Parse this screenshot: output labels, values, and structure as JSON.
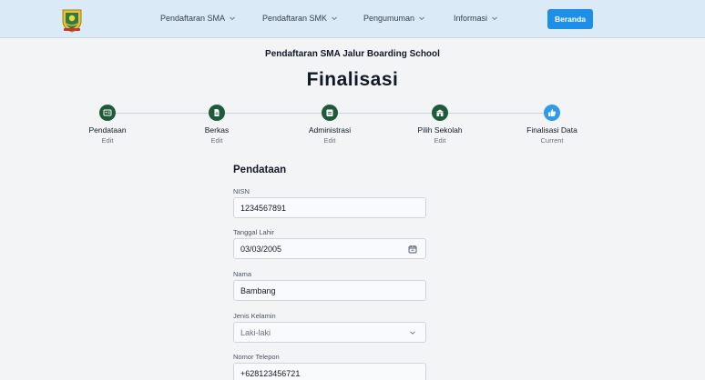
{
  "nav": {
    "items": [
      {
        "label": "Pendaftaran SMA"
      },
      {
        "label": "Pendaftaran SMK"
      },
      {
        "label": "Pengumuman"
      },
      {
        "label": "Informasi"
      }
    ],
    "home_button": "Beranda"
  },
  "header": {
    "subtitle": "Pendaftaran SMA Jalur Boarding School",
    "title": "Finalisasi"
  },
  "steps": [
    {
      "label": "Pendataan",
      "status": "Edit",
      "icon": "id-card-icon"
    },
    {
      "label": "Berkas",
      "status": "Edit",
      "icon": "file-icon"
    },
    {
      "label": "Administrasi",
      "status": "Edit",
      "icon": "clipboard-icon"
    },
    {
      "label": "Pilih Sekolah",
      "status": "Edit",
      "icon": "school-icon"
    },
    {
      "label": "Finalisasi Data",
      "status": "Current",
      "icon": "thumbs-up-icon"
    }
  ],
  "form": {
    "section_title": "Pendataan",
    "nisn": {
      "label": "NISN",
      "value": "1234567891"
    },
    "birth_date": {
      "label": "Tanggal Lahir",
      "value": "03/03/2005"
    },
    "name": {
      "label": "Nama",
      "value": "Bambang"
    },
    "gender": {
      "label": "Jenis Kelamin",
      "value": "Laki-laki"
    },
    "phone": {
      "label": "Nomor Telepon",
      "value": "+628123456721"
    }
  },
  "colors": {
    "navbar_bg": "#dbeaf7",
    "primary_button": "#1e8fe8",
    "step_done": "#1f5b3a",
    "step_current": "#2f9be6"
  }
}
